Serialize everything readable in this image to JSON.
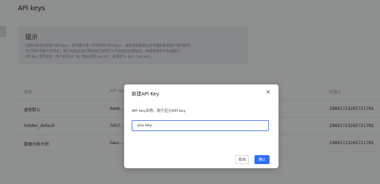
{
  "page": {
    "title": "API keys"
  },
  "hint": {
    "title": "提示",
    "lines": [
      "列表内是您的全部 API keys。请不要与他人共享您的 API Keys，避免将其暴露在浏览器和其他客户端代码中。",
      "为了保护您帐户的安全，我们可能会自动更换我们发现已公开泄露的密钥信息。随便自家中平台编报的",
      "API Key 需同包含 \"用户标识 id\" 和 \"签名密钥 secret\"，即格式为 {id}.{secret}。"
    ]
  },
  "table": {
    "headers": [
      "名称",
      "API key",
      "所属人"
    ],
    "rows": [
      {
        "name": "虚拟默认",
        "key": "9aeb...",
        "owner": "2989172326572178​2"
      },
      {
        "name": "hidden_default",
        "key": "7657...",
        "owner": "2989172326572178​2"
      },
      {
        "name": "数据分析大师",
        "key": "0aoc...",
        "owner": "2989172326572178​2"
      }
    ]
  },
  "modal": {
    "title": "新建API Key",
    "field_label": "API key名称，用于区分API key",
    "input_value": "you key",
    "cancel_label": "取消",
    "ok_label": "确认"
  },
  "colors": {
    "primary": "#2f6ef7",
    "overlay": "rgba(0,0,0,0.42)"
  }
}
